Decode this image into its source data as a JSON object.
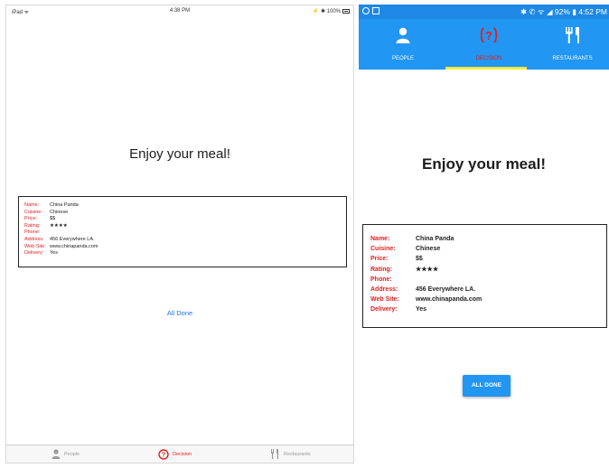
{
  "ipad": {
    "status": {
      "left": "iPad ᯤ",
      "time": "4:38 PM",
      "right": "⚡ ✱ 100%"
    },
    "heading": "Enjoy your meal!",
    "details": [
      {
        "label": "Name:",
        "value": "China Panda"
      },
      {
        "label": "Cuisine:",
        "value": "Chinese"
      },
      {
        "label": "Price:",
        "value": "$$"
      },
      {
        "label": "Rating:",
        "value": "★★★★"
      },
      {
        "label": "Phone:",
        "value": ""
      },
      {
        "label": "Address:",
        "value": "456 Everywhere LA."
      },
      {
        "label": "Web Site:",
        "value": "www.chinapanda.com"
      },
      {
        "label": "Delivery:",
        "value": "Yes"
      }
    ],
    "done_label": "All Done",
    "tabs": [
      {
        "label": "People",
        "icon": "person-icon"
      },
      {
        "label": "Decision",
        "icon": "question-icon"
      },
      {
        "label": "Restaurants",
        "icon": "utensils-icon"
      }
    ]
  },
  "android": {
    "status": {
      "right": "✱ ✆ ᯤ ◢ 92% ▮ 4:52 PM"
    },
    "tabs": [
      {
        "label": "PEOPLE",
        "icon": "person-icon"
      },
      {
        "label": "DECISION",
        "icon": "question-icon"
      },
      {
        "label": "RESTAURANTS",
        "icon": "utensils-icon"
      }
    ],
    "heading": "Enjoy your meal!",
    "details": [
      {
        "label": "Name:",
        "value": "China Panda"
      },
      {
        "label": "Cuisine:",
        "value": "Chinese"
      },
      {
        "label": "Price:",
        "value": "$$"
      },
      {
        "label": "Rating:",
        "value": "★★★★"
      },
      {
        "label": "Phone:",
        "value": ""
      },
      {
        "label": "Address:",
        "value": "456 Everywhere LA."
      },
      {
        "label": "Web Site:",
        "value": "www.chinapanda.com"
      },
      {
        "label": "Delivery:",
        "value": "Yes"
      }
    ],
    "button_label": "ALL DONE"
  },
  "colors": {
    "accent": "#2196f3",
    "label_red": "#e02020",
    "tab_indicator": "#ffeb3b",
    "ios_link": "#1a73e8"
  }
}
